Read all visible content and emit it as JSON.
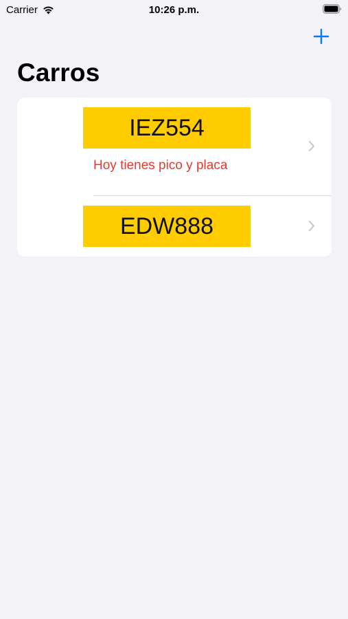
{
  "status_bar": {
    "carrier": "Carrier",
    "time": "10:26 p.m.",
    "icons": [
      "wifi-icon",
      "battery-icon"
    ]
  },
  "nav": {
    "title": "Carros",
    "add_icon": "plus-icon",
    "accent_color": "#007aff"
  },
  "cars": [
    {
      "plate": "IEZ554",
      "warning": "Hoy tienes pico y placa"
    },
    {
      "plate": "EDW888",
      "warning": ""
    }
  ],
  "colors": {
    "background": "#f2f2f7",
    "plate": "#ffcc00",
    "warning": "#e5382f",
    "chevron": "#c4c4c7"
  }
}
